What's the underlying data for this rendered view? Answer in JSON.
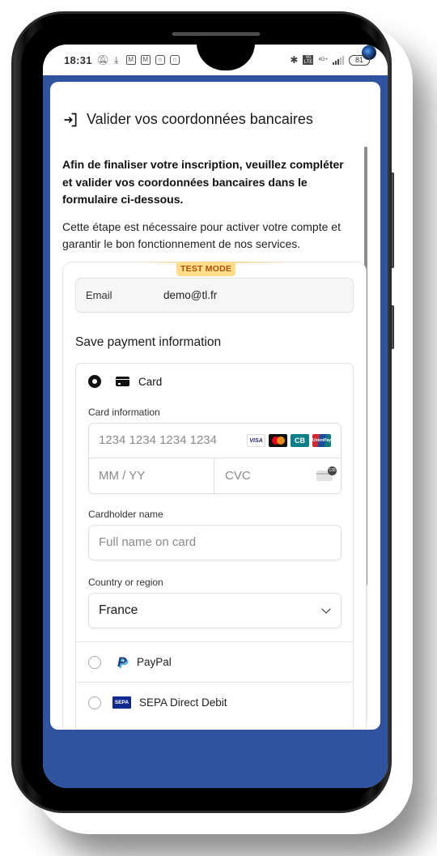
{
  "status_bar": {
    "time": "18:31",
    "left_icons": [
      "bell-off-icon",
      "download-icon",
      "gmail-icon",
      "gmail-icon",
      "instagram-icon",
      "instagram-icon"
    ],
    "right_icons": [
      "bluetooth-icon",
      "volte-icon",
      "signal-icon"
    ],
    "network": "4G+",
    "volte_label": "Vo LTE",
    "battery": "81"
  },
  "dialog": {
    "title": "Valider vos coordonnées bancaires",
    "title_icon": "login-icon",
    "intro_bold": "Afin de finaliser votre inscription, veuillez compléter et valider vos coordonnées bancaires dans le formulaire ci-dessous.",
    "intro_normal": "Cette étape est nécessaire pour activer votre compte et garantir le bon fonctionnement de nos services."
  },
  "stripe": {
    "test_mode_badge": "TEST MODE",
    "email_label": "Email",
    "email_value": "demo@tl.fr",
    "section_title": "Save payment information",
    "payment_methods": [
      {
        "label": "Card",
        "icon": "credit-card-icon",
        "selected": true
      },
      {
        "label": "PayPal",
        "icon": "paypal-icon",
        "selected": false
      },
      {
        "label": "SEPA Direct Debit",
        "icon": "sepa-icon",
        "selected": false
      }
    ],
    "card": {
      "info_label": "Card information",
      "number_placeholder": "1234 1234 1234 1234",
      "expiry_placeholder": "MM / YY",
      "cvc_placeholder": "CVC",
      "brands": [
        "VISA",
        "Mastercard",
        "CB",
        "UnionPay"
      ],
      "brand_visa_text": "VISA",
      "brand_cb_text": "CB",
      "brand_up_text": "UnionPay",
      "cardholder_label": "Cardholder name",
      "cardholder_placeholder": "Full name on card",
      "country_label": "Country or region",
      "country_value": "France"
    },
    "sepa_logo_text": "SEPA"
  },
  "colors": {
    "app_background": "#30539f",
    "test_badge_bg": "#ffdd8a",
    "test_badge_text": "#a8520b"
  }
}
